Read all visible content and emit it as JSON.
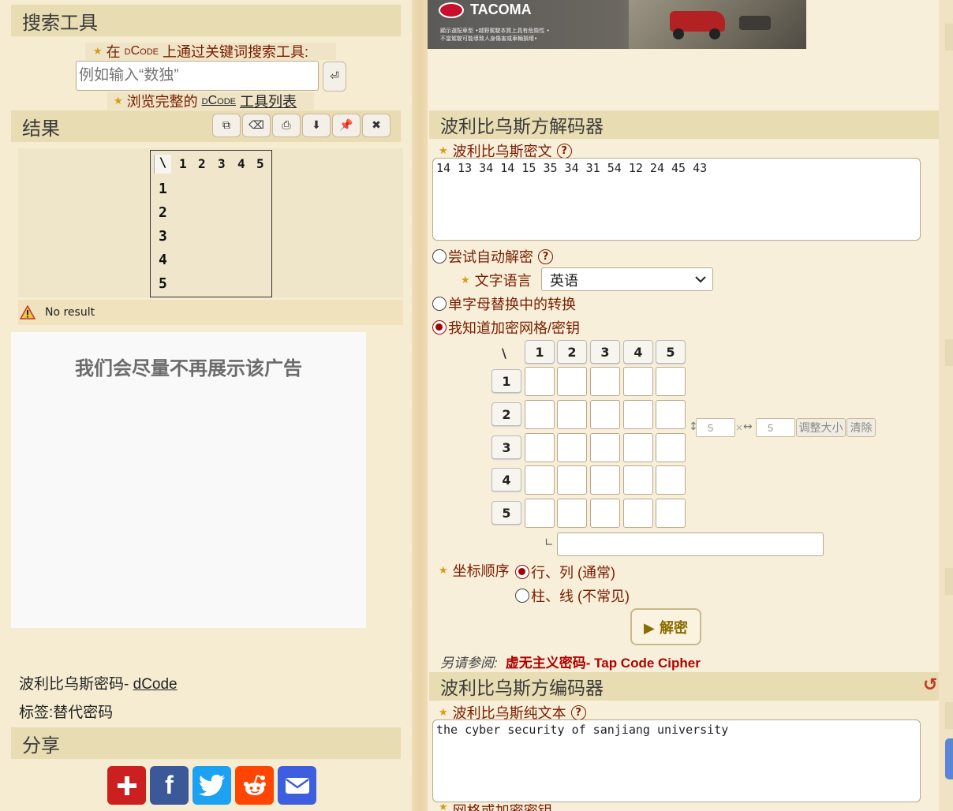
{
  "left": {
    "search_title": "搜索工具",
    "search_prompt_prefix": "在",
    "search_prompt_brand": "dCode",
    "search_prompt_suffix": "上通过关键词搜索工具:",
    "search_placeholder": "例如输入“数独”",
    "enter_glyph": "⏎",
    "browse_prefix": "浏览完整的",
    "browse_brand": "dCode",
    "browse_suffix": "工具列表",
    "results_title": "结果",
    "result_grid": {
      "corner": "\\",
      "cols": [
        "1",
        "2",
        "3",
        "4",
        "5"
      ],
      "rows": [
        "1",
        "2",
        "3",
        "4",
        "5"
      ]
    },
    "no_result": "No result",
    "ad_text": "我们会尽量不再展示该广告",
    "cipher_name": "波利比乌斯密码",
    "cipher_sep": "- ",
    "cipher_link": "dCode",
    "tags_label": "标签:",
    "tags_value": "替代密码",
    "share_title": "分享"
  },
  "banner": {
    "brand": "TACOMA",
    "line1": "顯示選配車型 •越野駕駛本質上具有危險性 •",
    "line2": "不當駕駛可能導致人身傷害或車輛損壞•"
  },
  "decoder": {
    "title": "波利比乌斯方解码器",
    "ciphertext_label": "波利比乌斯密文",
    "ciphertext_value": "14 13 34 14 15 35 34 31 54 12 24 45 43",
    "auto_decrypt_label": "尝试自动解密",
    "language_label": "文字语言",
    "language_value": "英语",
    "mono_subst_label": "单字母替换中的转换",
    "known_grid_label": "我知道加密网格/密钥",
    "grid_corner": "\\",
    "grid_cols": [
      "1",
      "2",
      "3",
      "4",
      "5"
    ],
    "grid_rows": [
      "1",
      "2",
      "3",
      "4",
      "5"
    ],
    "size_rows": "5",
    "size_cols": "5",
    "times": "×",
    "updown": "↕",
    "leftright": "↔",
    "resize_label": "调整大小",
    "clear_label": "清除",
    "corner_glyph": "∟",
    "coord_order_label": "坐标顺序",
    "coord_opt1": "行、列 (通常)",
    "coord_opt2": "柱、线 (不常见)",
    "decrypt_label": "▶ 解密",
    "see_also_label": "另请参阅:",
    "see_also_link1": "虚无主义密码",
    "see_also_sep": "- ",
    "see_also_link2": "Tap Code Cipher"
  },
  "encoder": {
    "title": "波利比乌斯方编码器",
    "reset_glyph": "↺",
    "plaintext_label": "波利比乌斯纯文本",
    "plaintext_value": "the cyber security of sanjiang university",
    "next_label": "网格或加密密钥"
  },
  "icons": {
    "toolbar": [
      "copy-icon",
      "eraser-icon",
      "print-icon",
      "download-icon",
      "pin-icon",
      "close-icon"
    ],
    "share": [
      "plus-share-icon",
      "facebook-icon",
      "twitter-icon",
      "reddit-icon",
      "email-icon"
    ]
  },
  "colors": {
    "accent": "#7a1d00",
    "header_bg": "#e8dcb2",
    "radio_on": "#a10000",
    "decrypt_text": "#8a6d00",
    "see_also_link": "#b00000"
  }
}
